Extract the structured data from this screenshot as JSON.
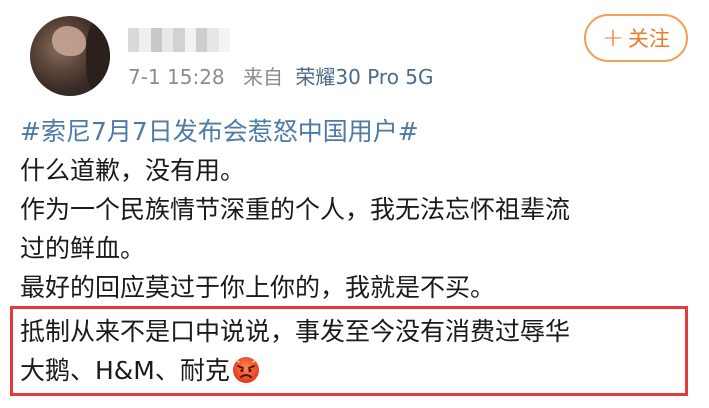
{
  "post": {
    "time": "7-1 15:28",
    "source_prefix": "来自",
    "device": "荣耀30 Pro 5G",
    "follow_label": "关注",
    "follow_plus": "+",
    "hashtag": "#索尼7月7日发布会惹怒中国用户#",
    "lines": [
      "什么道歉，没有用。",
      "作为一个民族情节深重的个人，我无法忘怀祖辈流",
      "过的鲜血。",
      "最好的回应莫过于你上你的，我就是不买。"
    ],
    "highlighted_lines": [
      "抵制从来不是口中说说，事发至今没有消费过辱华",
      "大鹅、H&M、耐克"
    ],
    "emoji_name": "angry-face-icon"
  },
  "colors": {
    "accent_orange": "#ee7b2a",
    "link_blue": "#4e7aa7",
    "highlight_red": "#e33b3b"
  }
}
